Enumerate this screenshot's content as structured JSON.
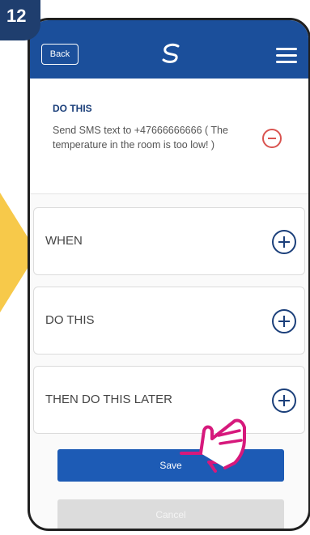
{
  "step": {
    "number": "12"
  },
  "header": {
    "back_label": "Back"
  },
  "rule_card": {
    "heading": "DO THIS",
    "text": "Send SMS text to +47666666666 ( The temperature in the room is too low! )"
  },
  "sections": [
    {
      "label": "WHEN"
    },
    {
      "label": "DO THIS"
    },
    {
      "label": "THEN DO THIS LATER"
    }
  ],
  "actions": {
    "save_label": "Save",
    "cancel_label": "Cancel"
  },
  "colors": {
    "header_blue": "#1b4f9b",
    "badge_navy": "#1f3e6e",
    "save_blue": "#1d5bb5",
    "remove_red": "#d9534f",
    "highlight_yellow": "#f7c94a",
    "hand_magenta": "#d6197c"
  },
  "icons": [
    "logo-icon",
    "menu-icon",
    "minus-circle-icon",
    "plus-circle-icon",
    "pointing-hand-icon",
    "arrow-icon"
  ]
}
